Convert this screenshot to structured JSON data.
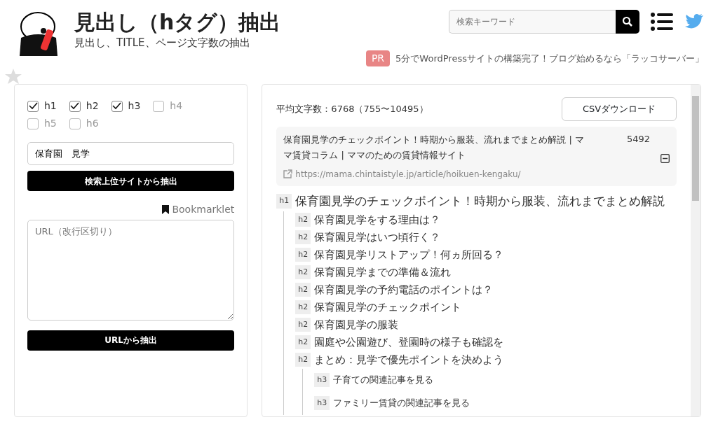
{
  "header": {
    "title": "見出し（hタグ）抽出",
    "subtitle": "見出し、TITLE、ページ文字数の抽出",
    "search": {
      "placeholder": "検索キーワード"
    }
  },
  "ad": {
    "badge": "PR",
    "text": "5分でWordPressサイトの構築完了！ブログ始めるなら「ラッコサーバー」"
  },
  "levels": [
    {
      "label": "h1",
      "checked": true
    },
    {
      "label": "h2",
      "checked": true
    },
    {
      "label": "h3",
      "checked": true
    },
    {
      "label": "h4",
      "checked": false
    },
    {
      "label": "h5",
      "checked": false
    },
    {
      "label": "h6",
      "checked": false
    }
  ],
  "keyword": {
    "value": "保育園　見学"
  },
  "search_button": "検索上位サイトから抽出",
  "bookmarklet": "Bookmarklet",
  "urls": {
    "placeholder": "URL（改行区切り）"
  },
  "url_button": "URLから抽出",
  "summary": "平均文字数：6768（755〜10495）",
  "csv_button": "CSVダウンロード",
  "result": {
    "title": "保育園見学のチェックポイント！時期から服装、流れまでまとめ解説 | ママ賃貸コラム | ママのための賃貸情報サイト",
    "count": "5492",
    "url": "https://mama.chintaistyle.jp/article/hoikuen-kengaku/",
    "expanded": true,
    "headings": [
      {
        "tag": "h1",
        "text": "保育園見学のチェックポイント！時期から服装、流れまでまとめ解説",
        "children": [
          {
            "tag": "h2",
            "text": "保育園見学をする理由は？"
          },
          {
            "tag": "h2",
            "text": "保育園見学はいつ頃行く？"
          },
          {
            "tag": "h2",
            "text": "保育園見学リストアップ！何ヵ所回る？"
          },
          {
            "tag": "h2",
            "text": "保育園見学までの準備＆流れ"
          },
          {
            "tag": "h2",
            "text": "保育園見学の予約電話のポイントは？"
          },
          {
            "tag": "h2",
            "text": "保育園見学のチェックポイント"
          },
          {
            "tag": "h2",
            "text": "保育園見学の服装"
          },
          {
            "tag": "h2",
            "text": "園庭や公園遊び、登園時の様子も確認を"
          },
          {
            "tag": "h2",
            "text": "まとめ：見学で優先ポイントを決めよう",
            "children": [
              {
                "tag": "h3",
                "text": "子育ての関連記事を見る"
              },
              {
                "tag": "h3",
                "text": "ファミリー賃貸の関連記事を見る"
              }
            ]
          }
        ]
      }
    ]
  }
}
